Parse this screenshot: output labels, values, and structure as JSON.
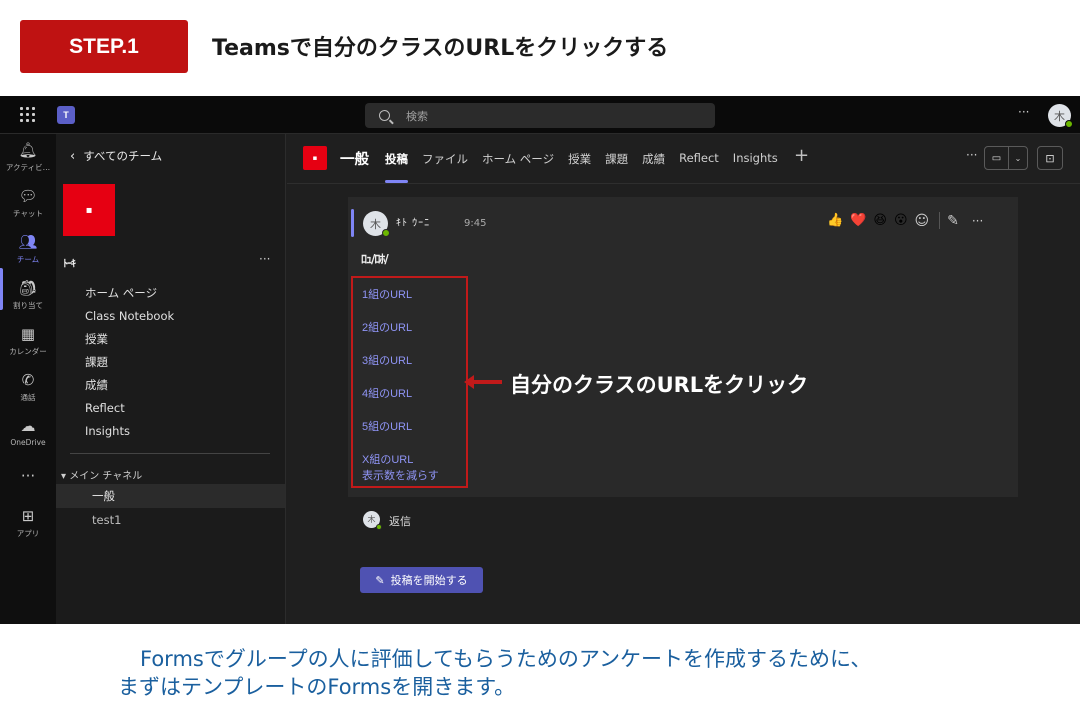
{
  "step": {
    "badge": "STEP.1",
    "title": "Teamsで自分のクラスのURLをクリックする"
  },
  "topbar": {
    "search_placeholder": "検索",
    "more": "···",
    "avatar_initial": "木"
  },
  "rail": [
    {
      "label": "アクティビ…",
      "icon": "bell-icon",
      "glyph": "🔔︎"
    },
    {
      "label": "チャット",
      "icon": "chat-icon",
      "glyph": "💬︎"
    },
    {
      "label": "チーム",
      "icon": "teams-icon",
      "glyph": "👥︎"
    },
    {
      "label": "割り当て",
      "icon": "assignments-icon",
      "glyph": "🎒︎"
    },
    {
      "label": "カレンダー",
      "icon": "calendar-icon",
      "glyph": "▦"
    },
    {
      "label": "通話",
      "icon": "phone-icon",
      "glyph": "✆"
    },
    {
      "label": "OneDrive",
      "icon": "cloud-icon",
      "glyph": "☁"
    },
    {
      "label": "",
      "icon": "more-icon",
      "glyph": "···"
    },
    {
      "label": "アプリ",
      "icon": "apps-icon",
      "glyph": "⊞"
    }
  ],
  "panel": {
    "back_label": "すべてのチーム",
    "team_name": "ﾄｰｷ",
    "nav": [
      "ホーム ページ",
      "Class Notebook",
      "授業",
      "課題",
      "成績",
      "Reflect",
      "Insights"
    ],
    "channels_header": "メイン チャネル",
    "channels": [
      "一般",
      "test1"
    ]
  },
  "channel_header": {
    "title": "一般",
    "tabs": [
      "投稿",
      "ファイル",
      "ホーム ページ",
      "授業",
      "課題",
      "成績",
      "Reflect",
      "Insights"
    ],
    "add_tab": "+"
  },
  "post": {
    "author": "ｷﾄ ｳｰﾆ",
    "time": "9:45",
    "subject": "ﾛｭ/ﾛﾎ/",
    "links": [
      "1組のURL",
      "2組のURL",
      "3組のURL",
      "4組のURL",
      "5組のURL",
      "X組のURL"
    ],
    "show_less": "表示数を減らす",
    "reactions": [
      "👍",
      "❤️",
      "😆",
      "😮"
    ],
    "reply_label": "返信"
  },
  "callout": "自分のクラスのURLをクリック",
  "new_post_label": "投稿を開始する",
  "footer": {
    "line1": "Formsでグループの人に評価してもらうためのアンケートを作成するために、",
    "line2": "まずはテンプレートのFormsを開きます。"
  },
  "colors": {
    "badge_red": "#bf1212",
    "teams_purple": "#7f85f5",
    "annotation_red": "#c11a1a",
    "footer_blue": "#1a5f9e"
  }
}
